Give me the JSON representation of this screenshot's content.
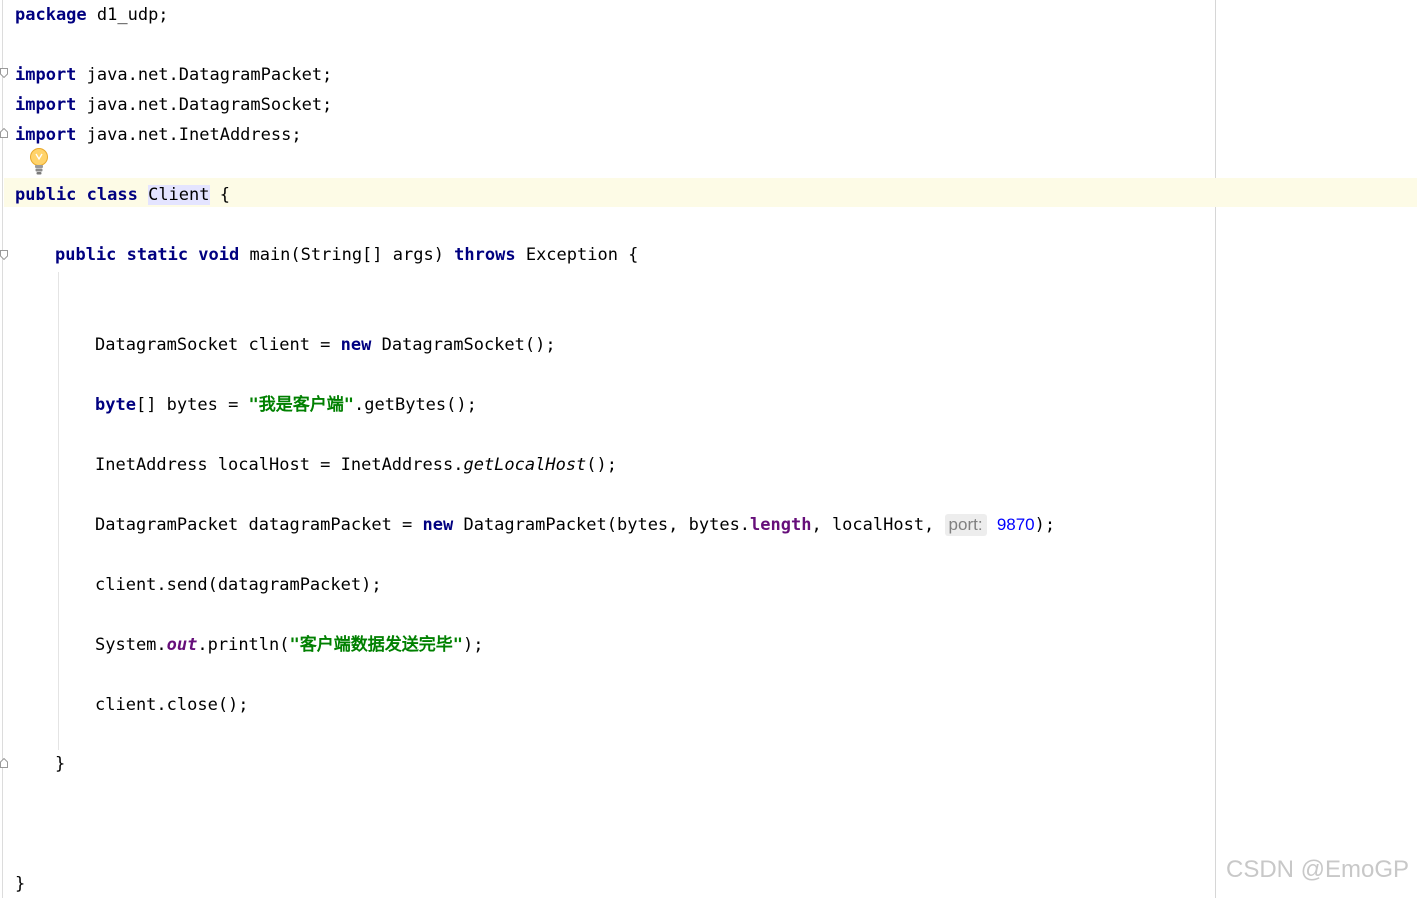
{
  "editor": {
    "language": "Java",
    "colors": {
      "keyword": "#000080",
      "string": "#008000",
      "field": "#660e7a",
      "number": "#0000ff",
      "caret_row": "#fdfbe6",
      "class_highlight": "#e4e4ff",
      "hint_background": "#ededed"
    },
    "intention_icon": "lightbulb-icon",
    "lines": {
      "package": {
        "kw": "package",
        "rest": " d1_udp;"
      },
      "import1": {
        "kw": "import",
        "rest": " java.net.DatagramPacket;"
      },
      "import2": {
        "kw": "import",
        "rest": " java.net.DatagramSocket;"
      },
      "import3": {
        "kw": "import",
        "rest": " java.net.InetAddress;"
      },
      "class_decl": {
        "kw": "public class",
        "sp": " ",
        "name": "Client",
        "rest": " {"
      },
      "main_decl": {
        "kw1": "public static void",
        "mid": " main(String[] args) ",
        "kw2": "throws",
        "rest": " Exception {"
      },
      "socket_line": {
        "pre": "DatagramSocket client = ",
        "kw": "new",
        "rest": " DatagramSocket();"
      },
      "bytes_line": {
        "kw": "byte",
        "mid": "[] bytes = ",
        "str": "\"我是客户端\"",
        "rest": ".getBytes();"
      },
      "host_line": {
        "pre": "InetAddress localHost = InetAddress.",
        "call": "getLocalHost",
        "rest": "();"
      },
      "packet_line": {
        "pre": "DatagramPacket datagramPacket = ",
        "kw": "new",
        "mid1": " DatagramPacket(bytes, bytes.",
        "field": "length",
        "mid2": ", localHost, ",
        "hint": "port:",
        "num": "9870",
        "rest": ");"
      },
      "send_line": {
        "text": "client.send(datagramPacket);"
      },
      "println_line": {
        "pre": "System.",
        "field": "out",
        "mid": ".println(",
        "str": "\"客户端数据发送完毕\"",
        "rest": ");"
      },
      "close_line": {
        "text": "client.close();"
      },
      "main_close": {
        "text": "}"
      },
      "class_close": {
        "text": "}"
      }
    }
  },
  "watermark": "CSDN @EmoGP"
}
